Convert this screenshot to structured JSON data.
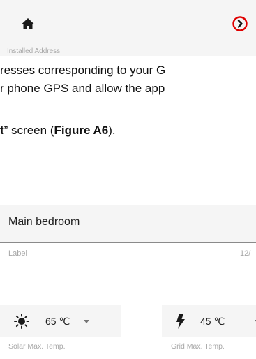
{
  "address_field": {
    "label": "Installed Address",
    "home_icon": "home-icon",
    "go_icon": "circle-chevron-right-icon",
    "go_icon_color": "#e00000"
  },
  "text": {
    "line1": "resses corresponding to your G",
    "line2": "r phone GPS and allow the app",
    "line3_bold1": "t",
    "line3_mid": "” screen (",
    "line3_bold2": "Figure A6",
    "line3_end": ")."
  },
  "label_field": {
    "value": "Main bedroom",
    "caption": "Label",
    "counter": "12/"
  },
  "solar_select": {
    "icon": "sun-icon",
    "value": "65 ℃",
    "caption": "Solar Max. Temp."
  },
  "grid_select": {
    "icon": "bolt-icon",
    "value": "45 ℃",
    "caption": "Grid Max. Temp."
  }
}
